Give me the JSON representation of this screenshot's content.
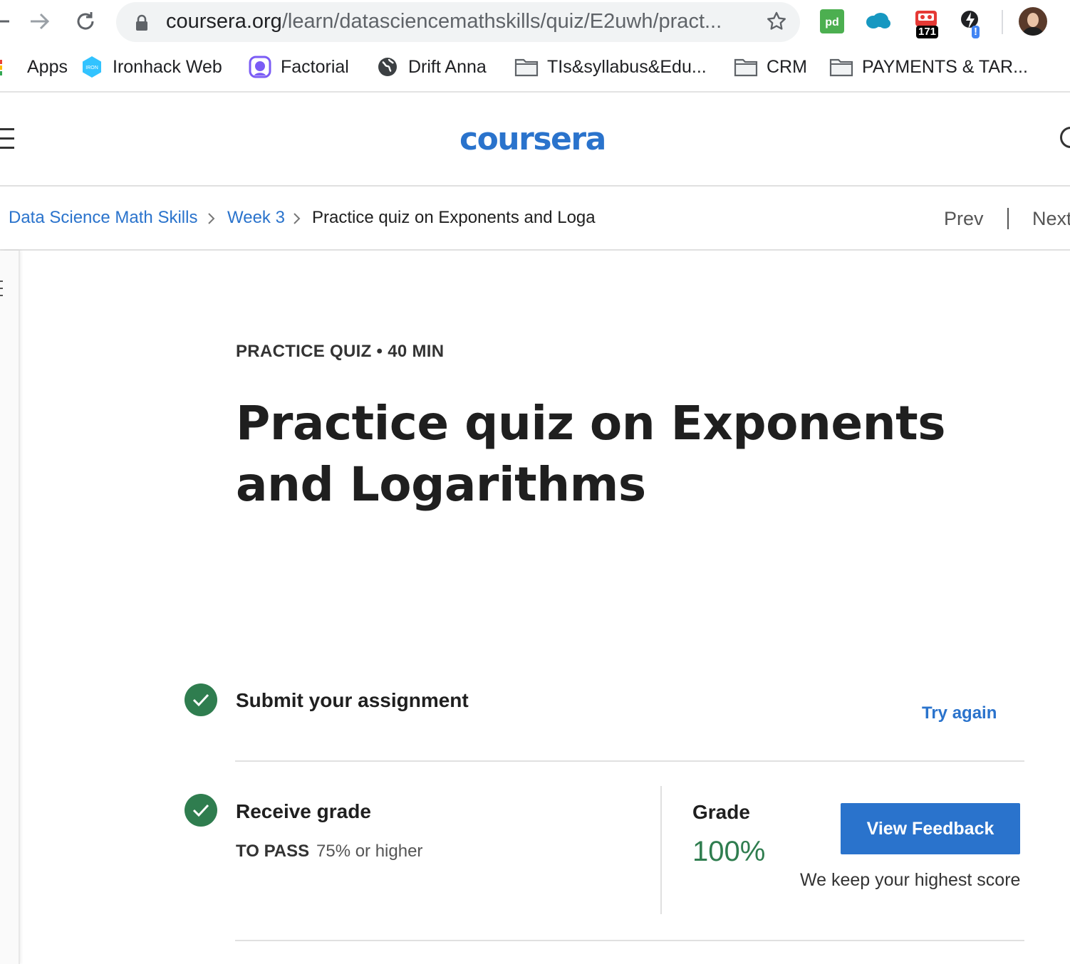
{
  "browser": {
    "url_domain": "coursera.org",
    "url_path": "/learn/datasciencemathskills/quiz/E2uwh/pract...",
    "extensions": {
      "badge_count": "171",
      "alert_badge": "!"
    }
  },
  "bookmarks": [
    {
      "label": "Apps",
      "icon": "apps-grid-icon"
    },
    {
      "label": "Ironhack Web",
      "icon": "ironhack-icon"
    },
    {
      "label": "Factorial",
      "icon": "factorial-icon"
    },
    {
      "label": "Drift Anna",
      "icon": "globe-icon"
    },
    {
      "label": "TIs&syllabus&Edu...",
      "icon": "folder-icon"
    },
    {
      "label": "CRM",
      "icon": "folder-icon"
    },
    {
      "label": "PAYMENTS & TAR...",
      "icon": "folder-icon"
    }
  ],
  "header": {
    "logo_text": "coursera"
  },
  "breadcrumb": {
    "items": [
      "Data Science Math Skills",
      "Week 3",
      "Practice quiz on Exponents and Loga"
    ],
    "prev_label": "Prev",
    "next_label": "Next"
  },
  "quiz": {
    "meta": "PRACTICE QUIZ • 40 MIN",
    "title": "Practice quiz on Exponents and Logarithms",
    "submit": {
      "title": "Submit your assignment",
      "action_label": "Try again"
    },
    "grade": {
      "title": "Receive grade",
      "to_pass_label": "TO PASS",
      "to_pass_value": "75% or higher",
      "grade_label": "Grade",
      "grade_value": "100%",
      "feedback_button": "View Feedback",
      "note": "We keep your highest score"
    }
  },
  "colors": {
    "accent_blue": "#2a73cc",
    "success_green": "#2f7d4f"
  }
}
